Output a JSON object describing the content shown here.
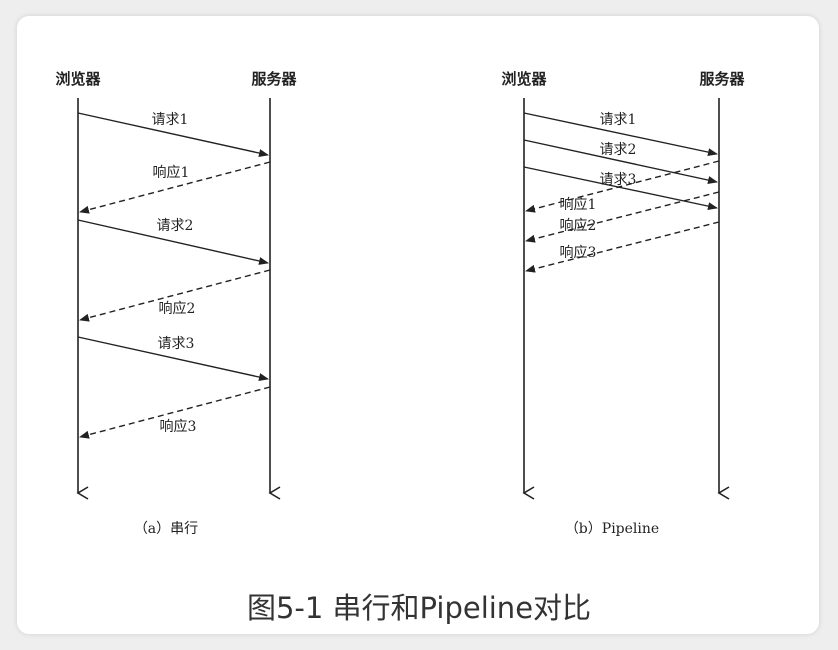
{
  "left_diagram": {
    "client_label": "浏览器",
    "server_label": "服务器",
    "messages": [
      "请求1",
      "响应1",
      "请求2",
      "响应2",
      "请求3",
      "响应3"
    ],
    "caption": "（a）串行"
  },
  "right_diagram": {
    "client_label": "浏览器",
    "server_label": "服务器",
    "messages": [
      "请求1",
      "请求2",
      "请求3",
      "响应1",
      "响应2",
      "响应3"
    ],
    "caption": "（b）Pipeline"
  },
  "figure_caption": "图5-1 串行和Pipeline对比"
}
